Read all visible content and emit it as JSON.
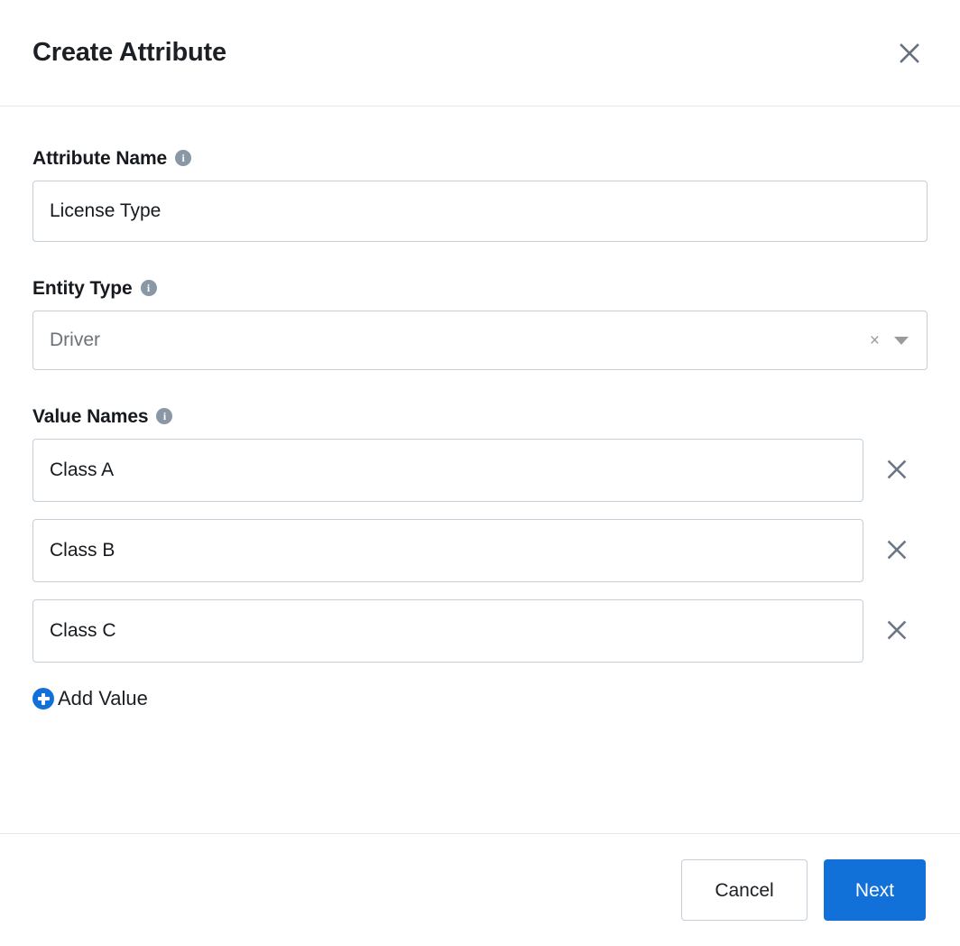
{
  "header": {
    "title": "Create Attribute",
    "close_icon": "close-icon"
  },
  "form": {
    "attribute_name": {
      "label": "Attribute Name",
      "info_icon": "i",
      "value": "License Type",
      "placeholder": ""
    },
    "entity_type": {
      "label": "Entity Type",
      "info_icon": "i",
      "value": "Driver",
      "clear_icon": "×",
      "caret_icon": "chevron-down-icon"
    },
    "value_names": {
      "label": "Value Names",
      "info_icon": "i",
      "values": [
        {
          "value": "Class A",
          "remove_icon": "close-icon"
        },
        {
          "value": "Class B",
          "remove_icon": "close-icon"
        },
        {
          "value": "Class C",
          "remove_icon": "close-icon"
        }
      ],
      "add_label": "Add Value",
      "add_icon": "plus-circle-icon"
    }
  },
  "footer": {
    "cancel_label": "Cancel",
    "next_label": "Next"
  },
  "colors": {
    "primary": "#1271d8",
    "text": "#1c1f23",
    "border": "#c5ced7",
    "divider": "#e4e7ea",
    "icon_gray": "#6b7785",
    "info_gray": "#8a97a5"
  }
}
